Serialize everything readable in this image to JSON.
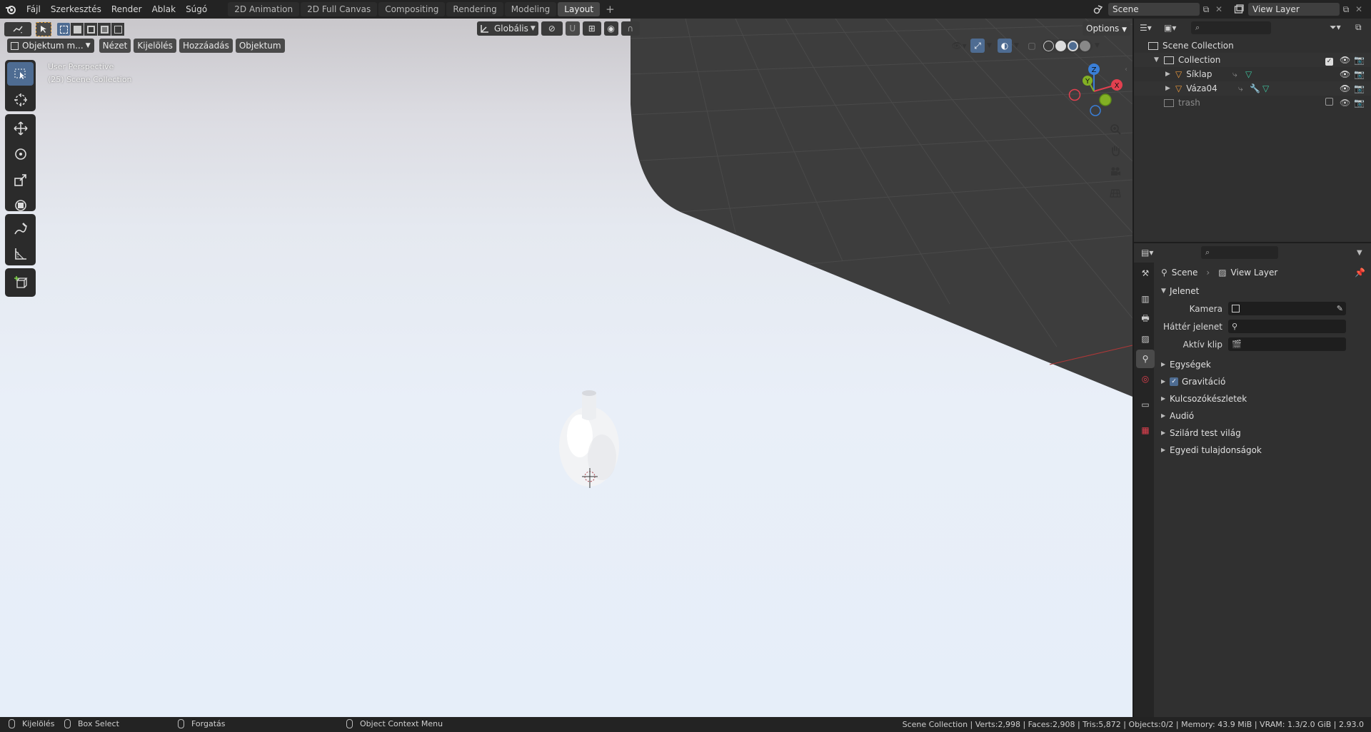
{
  "menus": [
    "Fájl",
    "Szerkesztés",
    "Render",
    "Ablak",
    "Súgó"
  ],
  "workspace_tabs": [
    {
      "label": "2D Animation",
      "active": false
    },
    {
      "label": "2D Full Canvas",
      "active": false
    },
    {
      "label": "Compositing",
      "active": false
    },
    {
      "label": "Rendering",
      "active": false
    },
    {
      "label": "Modeling",
      "active": false
    },
    {
      "label": "Layout",
      "active": true
    }
  ],
  "scene_field": "Scene",
  "view_layer_field": "View Layer",
  "viewport": {
    "mode_label": "Objektum m...",
    "header_menus": [
      "Nézet",
      "Kijelölés",
      "Hozzáadás",
      "Objektum"
    ],
    "transform_orientation": "Globális",
    "options_label": "Options",
    "overlay_line1": "User Perspective",
    "overlay_line2": "(25) Scene Collection",
    "gizmo_axes": {
      "x": "X",
      "y": "Y",
      "z": "Z"
    }
  },
  "outliner": {
    "root": "Scene Collection",
    "collection": "Collection",
    "objects": [
      "Síklap",
      "Váza04"
    ],
    "trash": "trash"
  },
  "properties": {
    "breadcrumb_scene": "Scene",
    "breadcrumb_view_layer": "View Layer",
    "panel_title": "Jelenet",
    "fields": [
      {
        "label": "Kamera"
      },
      {
        "label": "Háttér jelenet"
      },
      {
        "label": "Aktív klip"
      }
    ],
    "subpanels": [
      {
        "label": "Egységek",
        "checkbox": false
      },
      {
        "label": "Gravitáció",
        "checkbox": true
      },
      {
        "label": "Kulcsozókészletek",
        "checkbox": false
      },
      {
        "label": "Audió",
        "checkbox": false
      },
      {
        "label": "Szilárd test világ",
        "checkbox": false
      },
      {
        "label": "Egyedi tulajdonságok",
        "checkbox": false
      }
    ]
  },
  "status": {
    "left_1": "Kijelölés",
    "left_2": "Box Select",
    "left_3": "Forgatás",
    "left_4": "Object Context Menu",
    "right": "Scene Collection | Verts:2,998 | Faces:2,908 | Tris:5,872 | Objects:0/2 | Memory: 43.9 MiB | VRAM: 1.3/2.0 GiB | 2.93.0"
  },
  "colors": {
    "accent": "#4e6c92",
    "x_axis": "#e2404f",
    "y_axis": "#82b024",
    "z_axis": "#3a7fd8",
    "mesh_icon": "#ed9a3c",
    "data_icon": "#3ec49f"
  }
}
